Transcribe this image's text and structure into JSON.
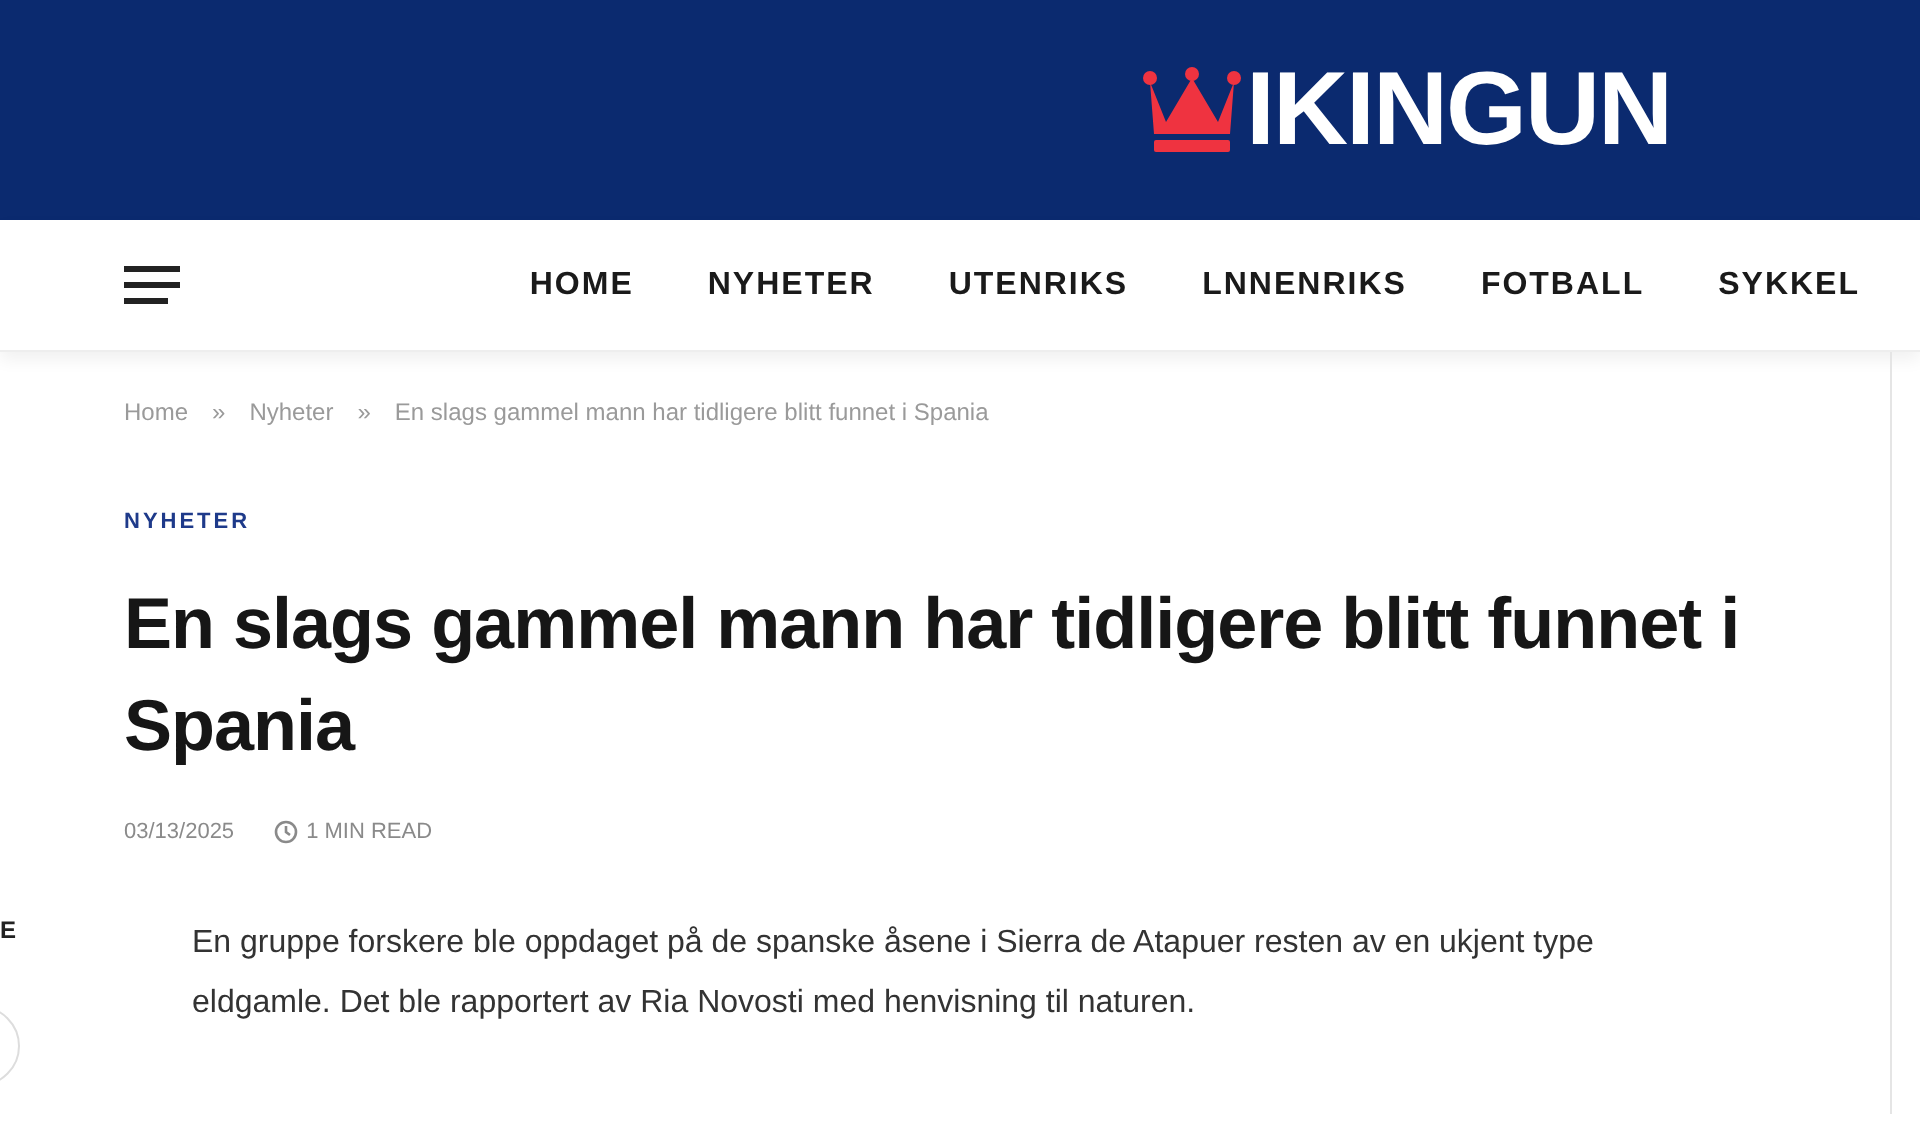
{
  "header": {
    "logo_text": "IKINGUN"
  },
  "nav": {
    "items": [
      {
        "label": "HOME"
      },
      {
        "label": "NYHETER"
      },
      {
        "label": "UTENRIKS"
      },
      {
        "label": "LNNENRIKS"
      },
      {
        "label": "FOTBALL"
      },
      {
        "label": "SYKKEL"
      }
    ]
  },
  "breadcrumb": [
    {
      "label": "Home",
      "separator": "»"
    },
    {
      "label": "Nyheter",
      "separator": "»"
    },
    {
      "label": "En slags gammel mann har tidligere blitt funnet i Spania"
    }
  ],
  "article": {
    "category": "NYHETER",
    "title": "En slags gammel mann har tidligere blitt funnet i Spania",
    "date": "03/13/2025",
    "read_time": "1 MIN READ",
    "lead": "En gruppe forskere ble oppdaget på de spanske åsene i Sierra de Atapuer resten av en ukjent type eldgamle. Det ble rapportert av Ria Novosti med henvisning til naturen."
  },
  "side_widget": {
    "label": "E"
  }
}
